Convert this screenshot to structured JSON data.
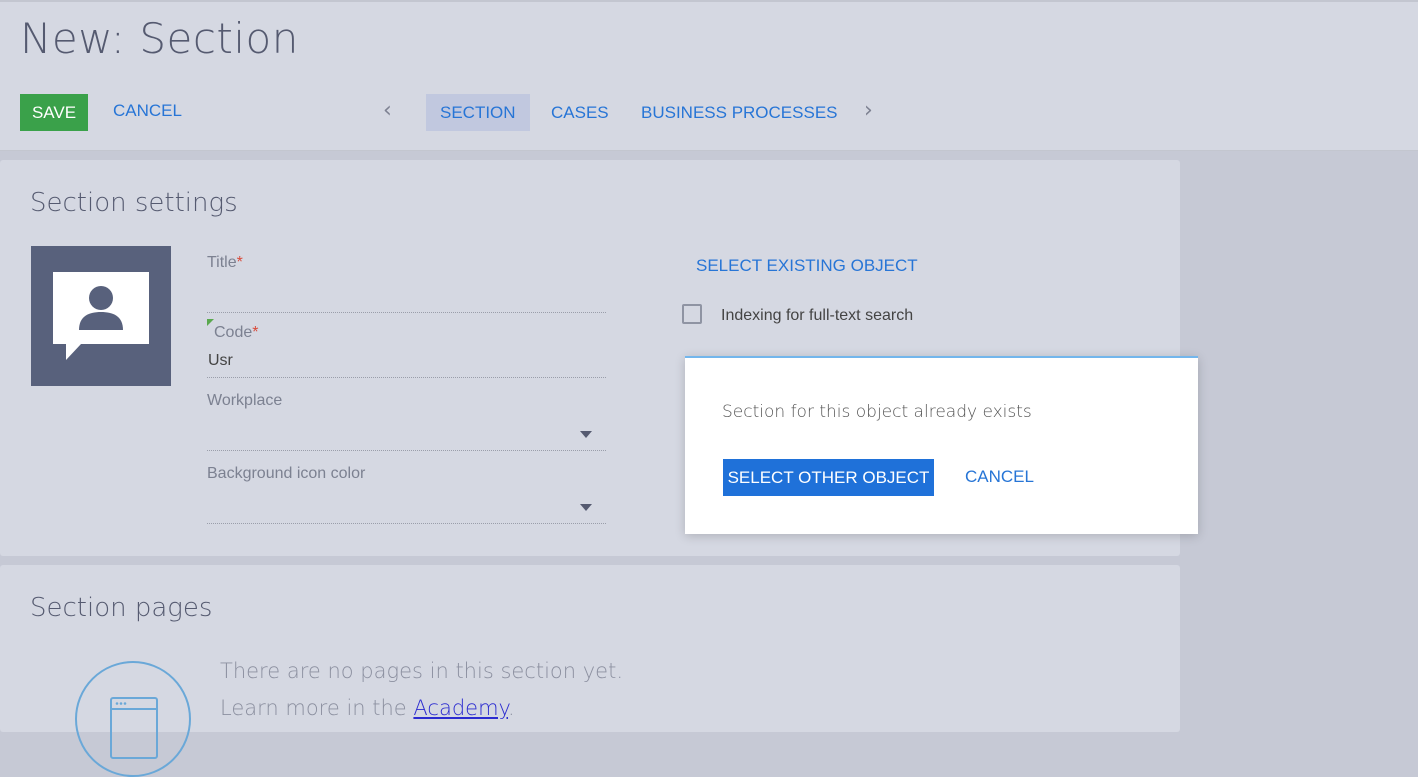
{
  "header": {
    "title": "New: Section",
    "save_label": "SAVE",
    "cancel_label": "CANCEL"
  },
  "tabs": [
    {
      "label": "SECTION",
      "active": true
    },
    {
      "label": "CASES",
      "active": false
    },
    {
      "label": "BUSINESS PROCESSES",
      "active": false
    }
  ],
  "section_settings": {
    "heading": "Section settings",
    "title_label": "Title",
    "title_value": "",
    "code_label": "Code",
    "code_value": "Usr",
    "workplace_label": "Workplace",
    "bg_color_label": "Background icon color",
    "required_mark": "*",
    "select_existing_label": "SELECT EXISTING OBJECT",
    "indexing_label": "Indexing for full-text search",
    "indexing_checked": false
  },
  "dialog": {
    "message": "Section for this object already exists",
    "primary_label": "SELECT OTHER OBJECT",
    "cancel_label": "CANCEL"
  },
  "section_pages": {
    "heading": "Section pages",
    "empty_line1": "There are no pages in this section yet.",
    "empty_line2_prefix": "Learn more in the ",
    "academy_link": "Academy",
    "empty_line2_suffix": "."
  },
  "colors": {
    "accent": "#2775d6",
    "save": "#3aa14a",
    "primary": "#1f71d9",
    "icon_bg": "#58617c"
  },
  "icons": [
    "chevron-left-icon",
    "chevron-right-icon",
    "section-person-icon",
    "page-window-icon",
    "dropdown-arrow-icon"
  ]
}
